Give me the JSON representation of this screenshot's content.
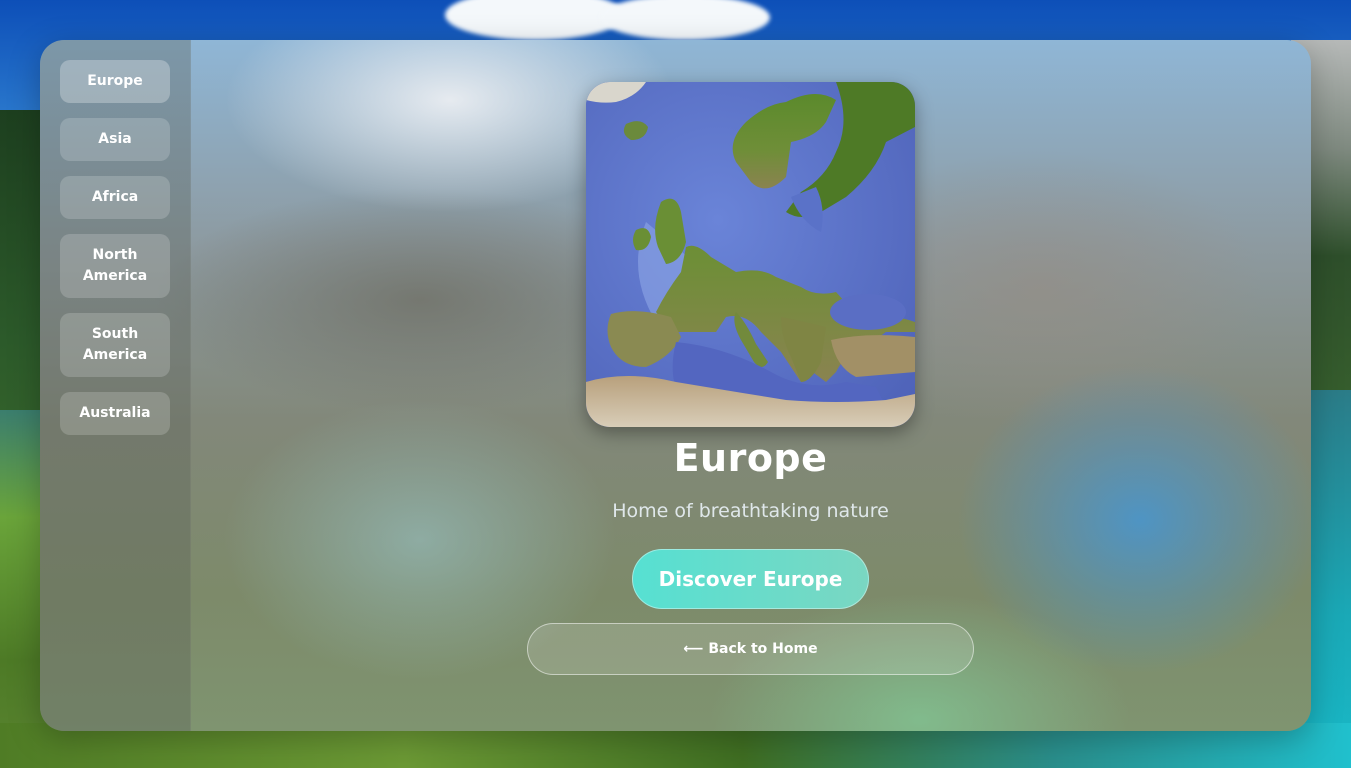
{
  "sidebar": {
    "items": [
      {
        "label": "Europe",
        "active": true
      },
      {
        "label": "Asia",
        "active": false
      },
      {
        "label": "Africa",
        "active": false
      },
      {
        "label": "North America",
        "active": false
      },
      {
        "label": "South America",
        "active": false
      },
      {
        "label": "Australia",
        "active": false
      }
    ]
  },
  "main": {
    "map_icon": "europe-map-image",
    "title": "Europe",
    "subtitle": "Home of breathtaking nature",
    "discover_label": "Discover Europe",
    "back_label": "⟵ Back to Home"
  },
  "colors": {
    "accent": "#5ee0d3",
    "text": "#ffffff"
  }
}
